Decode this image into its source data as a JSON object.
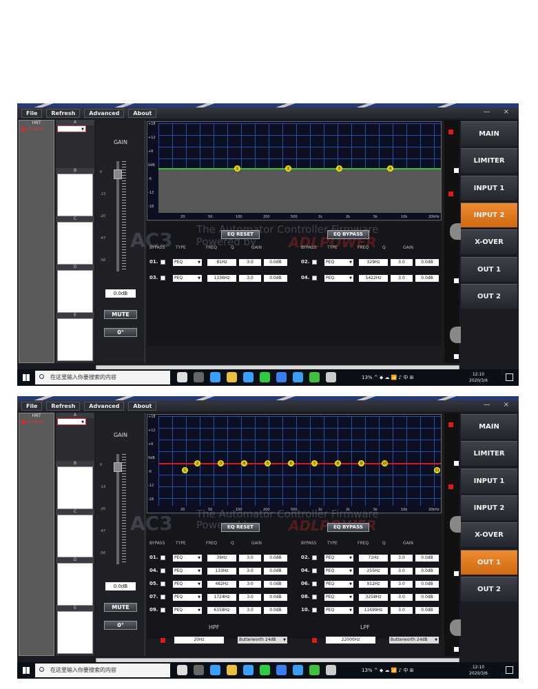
{
  "menu": [
    "File",
    "Refresh",
    "Advanced",
    "About"
  ],
  "window_controls": "— ×",
  "device_list": {
    "header": "HNT",
    "item": "01.AFD1"
  },
  "presets": [
    "A",
    "B",
    "C",
    "D",
    "E"
  ],
  "gain": {
    "label": "GAIN",
    "scale": [
      "0",
      "-13",
      "-20",
      "-47",
      "-56"
    ],
    "value": "0.0dB",
    "mute": "MUTE",
    "phase": "0°"
  },
  "graph": {
    "y_labels": [
      "+18",
      "+12",
      "+6",
      "0dB",
      "-6",
      "-12",
      "-18"
    ],
    "x_labels": [
      "20",
      "50",
      "100",
      "200",
      "500",
      "1k",
      "2k",
      "5k",
      "10k",
      "20kHz"
    ]
  },
  "watermark": {
    "logo": "AC3",
    "line1": "The Automator Controller Firmware",
    "line2": "Powered by",
    "brand": "ADLPOWER"
  },
  "eq": {
    "reset": "EQ RESET",
    "bypass_btn": "EQ BYPASS",
    "headers": [
      "BYPASS",
      "TYPE",
      "FREQ",
      "Q",
      "GAIN"
    ]
  },
  "nav": [
    "MAIN",
    "LIMITER",
    "INPUT 1",
    "INPUT 2",
    "X-OVER",
    "OUT 1",
    "OUT 2"
  ],
  "screen1": {
    "active_nav": 3,
    "bands": [
      "1",
      "2",
      "3",
      "4"
    ],
    "rows": [
      {
        "idx": "01.",
        "type": "PEQ",
        "freq": "81Hz",
        "q": "3.0",
        "gain": "0.0dB"
      },
      {
        "idx": "02.",
        "type": "PEQ",
        "freq": "329Hz",
        "q": "3.0",
        "gain": "0.0dB"
      },
      {
        "idx": "03.",
        "type": "PEQ",
        "freq": "1336Hz",
        "q": "3.0",
        "gain": "0.0dB"
      },
      {
        "idx": "04.",
        "type": "PEQ",
        "freq": "5422Hz",
        "q": "3.0",
        "gain": "0.0dB"
      }
    ]
  },
  "screen2": {
    "active_nav": 5,
    "bands": [
      "1",
      "2",
      "3",
      "4",
      "5",
      "6",
      "7",
      "8",
      "9",
      "10",
      "11"
    ],
    "rows": [
      {
        "idx": "01.",
        "type": "PEQ",
        "freq": "39Hz",
        "q": "3.0",
        "gain": "0.0dB"
      },
      {
        "idx": "02.",
        "type": "PEQ",
        "freq": "71Hz",
        "q": "3.0",
        "gain": "0.0dB"
      },
      {
        "idx": "04.",
        "type": "PEQ",
        "freq": "133Hz",
        "q": "3.0",
        "gain": "0.0dB"
      },
      {
        "idx": "04.",
        "type": "PEQ",
        "freq": "255Hz",
        "q": "3.0",
        "gain": "0.0dB"
      },
      {
        "idx": "05.",
        "type": "PEQ",
        "freq": "482Hz",
        "q": "3.0",
        "gain": "0.0dB"
      },
      {
        "idx": "06.",
        "type": "PEQ",
        "freq": "912Hz",
        "q": "3.0",
        "gain": "0.0dB"
      },
      {
        "idx": "07.",
        "type": "PEQ",
        "freq": "1724Hz",
        "q": "3.0",
        "gain": "0.0dB"
      },
      {
        "idx": "08.",
        "type": "PEQ",
        "freq": "3258Hz",
        "q": "3.0",
        "gain": "0.0dB"
      },
      {
        "idx": "09.",
        "type": "PEQ",
        "freq": "6158Hz",
        "q": "3.0",
        "gain": "0.0dB"
      },
      {
        "idx": "10.",
        "type": "PEQ",
        "freq": "11699Hz",
        "q": "3.0",
        "gain": "0.0dB"
      }
    ],
    "hpf": {
      "label": "HPF",
      "freq": "20Hz",
      "type": "Butterworth 24dB"
    },
    "lpf": {
      "label": "LPF",
      "freq": "22000Hz",
      "type": "Butterworth 24dB"
    }
  },
  "taskbar": {
    "search_placeholder": "在这里输入你要搜索的内容",
    "tray": "13%  ^  ◆ ☁ 📶 ♪ 中  ⊞",
    "time": "12:10",
    "date": "2020/3/6"
  },
  "colors": {
    "accent": "#e07a1f",
    "grid": "#2a4fa8",
    "band": "#d8c000",
    "curve_red": "#e01818"
  }
}
